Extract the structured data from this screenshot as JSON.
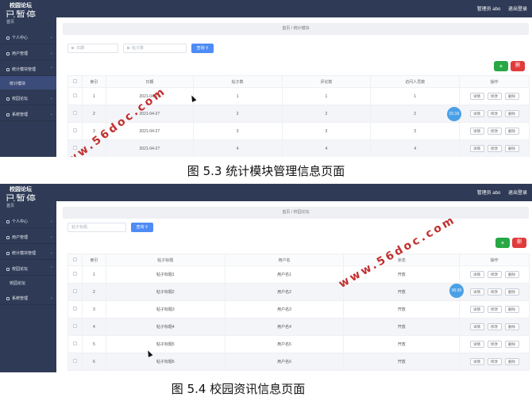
{
  "shared": {
    "brand": "校园论坛",
    "paused": "已暂停",
    "home": "首页",
    "admin_label": "管理员 abo",
    "logout_label": "退出登录",
    "search_btn": "查询",
    "add_btn": "+",
    "delete_btn": "删",
    "detail_btn": "详情",
    "edit_btn": "修改",
    "remove_btn": "删除",
    "watermark": "www.56doc.com"
  },
  "fig1": {
    "sidebar": [
      {
        "label": "个人中心"
      },
      {
        "label": "用户管理"
      },
      {
        "label": "统计模块管理"
      },
      {
        "label": "校园论坛"
      },
      {
        "label": "系统管理"
      }
    ],
    "sidebar_sub": "统计模块",
    "breadcrumb": "首页 / 统计模块",
    "filter1_placeholder": "日期",
    "filter2_placeholder": "帖子数",
    "columns": [
      "索引",
      "日期",
      "帖子数",
      "评论数",
      "访问人员数",
      "操作"
    ],
    "rows": [
      [
        "1",
        "2021-04-27",
        "1",
        "1",
        "1"
      ],
      [
        "2",
        "2021-04-27",
        "2",
        "2",
        "2"
      ],
      [
        "3",
        "2021-04-27",
        "3",
        "3",
        "3"
      ],
      [
        "",
        "2021-04-27",
        "4",
        "4",
        "4"
      ]
    ],
    "bubble": "01:16",
    "caption": "图 5.3 统计模块管理信息页面"
  },
  "fig2": {
    "sidebar": [
      {
        "label": "个人中心"
      },
      {
        "label": "用户管理"
      },
      {
        "label": "统计模块管理"
      },
      {
        "label": "校园论坛"
      },
      {
        "label": "系统管理"
      }
    ],
    "sidebar_sub": "校园论坛",
    "breadcrumb": "首页 / 校园论坛",
    "filter1_placeholder": "帖子标题",
    "columns": [
      "索引",
      "帖子标题",
      "用户名",
      "状态",
      "操作"
    ],
    "rows": [
      [
        "1",
        "帖子标题1",
        "用户名1",
        "开放"
      ],
      [
        "2",
        "帖子标题2",
        "用户名2",
        "开放"
      ],
      [
        "3",
        "帖子标题3",
        "用户名3",
        "开放"
      ],
      [
        "4",
        "帖子标题4",
        "用户名4",
        "开放"
      ],
      [
        "5",
        "帖子标题5",
        "用户名5",
        "开放"
      ],
      [
        "6",
        "帖子标题6",
        "用户名6",
        "开放"
      ]
    ],
    "bubble": "00:30",
    "caption": "图 5.4 校园资讯信息页面"
  }
}
